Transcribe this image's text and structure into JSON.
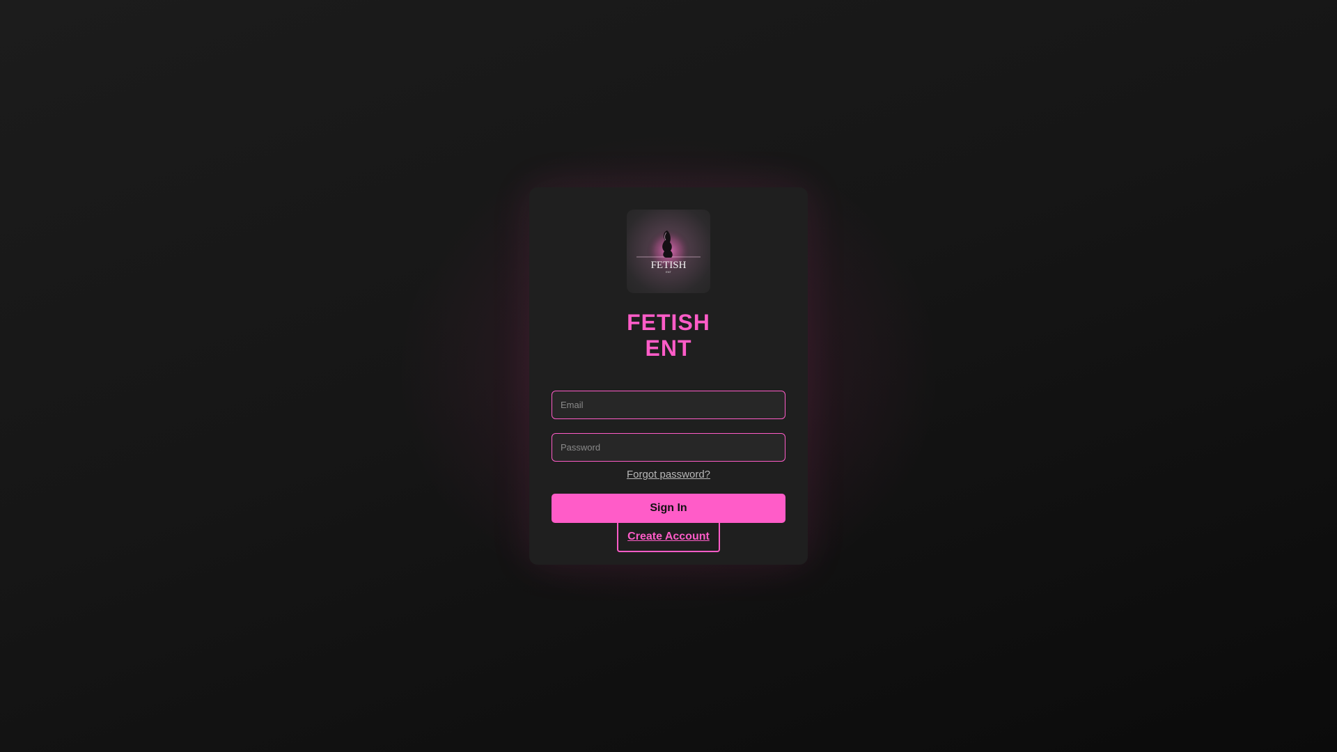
{
  "brand": {
    "logo_icon": "brand-logo-icon",
    "logo_text": "FETISH",
    "logo_subtext": "ENT",
    "title_line1": "FETISH",
    "title_line2": "ENT"
  },
  "form": {
    "email_placeholder": "Email",
    "email_value": "",
    "password_placeholder": "Password",
    "password_value": "",
    "forgot_label": "Forgot password?",
    "signin_label": "Sign In",
    "create_label": "Create Account"
  },
  "colors": {
    "accent": "#ff5cc8",
    "card_background": "#1f1f1f",
    "page_background": "#161616"
  }
}
